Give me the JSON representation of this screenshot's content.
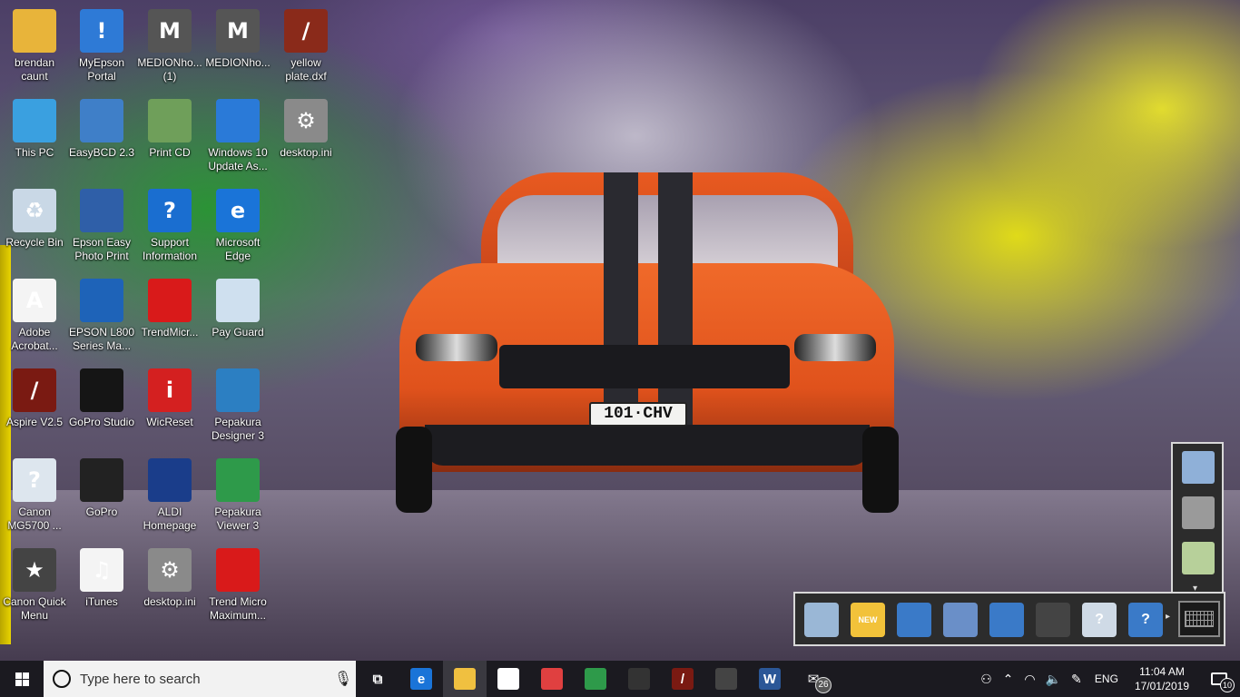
{
  "wallpaper": {
    "plate_text": "101·CHV"
  },
  "desktop_icons": [
    {
      "id": "brendan-caunt",
      "label": "brendan caunt",
      "icon": "user-folder-icon",
      "color": "#e8b43a",
      "glyph": "",
      "shortcut": false
    },
    {
      "id": "this-pc",
      "label": "This PC",
      "icon": "computer-icon",
      "color": "#3aa0e0",
      "glyph": "",
      "shortcut": false
    },
    {
      "id": "recycle-bin",
      "label": "Recycle Bin",
      "icon": "recycle-bin-icon",
      "color": "#c9d8e6",
      "glyph": "♻",
      "shortcut": false
    },
    {
      "id": "adobe-acrobat",
      "label": "Adobe Acrobat...",
      "icon": "acrobat-icon",
      "color": "#f4f4f4",
      "glyph": "A",
      "shortcut": true
    },
    {
      "id": "aspire",
      "label": "Aspire V2.5",
      "icon": "aspire-icon",
      "color": "#7a1a12",
      "glyph": "/",
      "shortcut": true
    },
    {
      "id": "canon-mg5700",
      "label": "Canon MG5700 ...",
      "icon": "canon-help-icon",
      "color": "#dde6ee",
      "glyph": "?",
      "shortcut": true
    },
    {
      "id": "canon-quick-menu",
      "label": "Canon Quick Menu",
      "icon": "canon-quick-menu-icon",
      "color": "#444",
      "glyph": "★",
      "shortcut": true
    },
    {
      "id": "myepson-portal",
      "label": "MyEpson Portal",
      "icon": "info-icon",
      "color": "#2e7ad6",
      "glyph": "!",
      "shortcut": true
    },
    {
      "id": "easybcd",
      "label": "EasyBCD 2.3",
      "icon": "easybcd-icon",
      "color": "#3f7fc8",
      "glyph": "",
      "shortcut": true
    },
    {
      "id": "epson-easy-photo-print",
      "label": "Epson Easy Photo Print",
      "icon": "photo-print-icon",
      "color": "#2f5fa8",
      "glyph": "",
      "shortcut": true
    },
    {
      "id": "epson-l800",
      "label": "EPSON L800 Series Ma...",
      "icon": "epson-manual-icon",
      "color": "#1e63b8",
      "glyph": "",
      "shortcut": true
    },
    {
      "id": "gopro-studio",
      "label": "GoPro Studio",
      "icon": "gopro-studio-icon",
      "color": "#151515",
      "glyph": "",
      "shortcut": true
    },
    {
      "id": "gopro",
      "label": "GoPro",
      "icon": "gopro-icon",
      "color": "#222",
      "glyph": "",
      "shortcut": true
    },
    {
      "id": "itunes",
      "label": "iTunes",
      "icon": "itunes-icon",
      "color": "#f4f4f4",
      "glyph": "♫",
      "shortcut": true
    },
    {
      "id": "medion-home-1",
      "label": "MEDIONho... (1)",
      "icon": "medion-icon",
      "color": "#555",
      "glyph": "M",
      "shortcut": true
    },
    {
      "id": "print-cd",
      "label": "Print CD",
      "icon": "print-cd-icon",
      "color": "#6f9f5a",
      "glyph": "",
      "shortcut": true
    },
    {
      "id": "support-information",
      "label": "Support Information",
      "icon": "help-icon",
      "color": "#1a6ed0",
      "glyph": "?",
      "shortcut": true
    },
    {
      "id": "trendmicro-1",
      "label": "TrendMicr...",
      "icon": "trendmicro-icon",
      "color": "#d91a1a",
      "glyph": "",
      "shortcut": false
    },
    {
      "id": "wicreset",
      "label": "WicReset",
      "icon": "wicreset-icon",
      "color": "#d42020",
      "glyph": "i",
      "shortcut": true
    },
    {
      "id": "aldi-homepage",
      "label": "ALDI Homepage",
      "icon": "aldi-icon",
      "color": "#1a3d8a",
      "glyph": "",
      "shortcut": false
    },
    {
      "id": "desktop-ini-1",
      "label": "desktop.ini",
      "icon": "ini-file-icon",
      "color": "#8a8a8a",
      "glyph": "⚙",
      "shortcut": false
    },
    {
      "id": "medion-home-2",
      "label": "MEDIONho...",
      "icon": "medion-icon",
      "color": "#555",
      "glyph": "M",
      "shortcut": true
    },
    {
      "id": "windows-10-update",
      "label": "Windows 10 Update As...",
      "icon": "windows-update-icon",
      "color": "#2a7ad8",
      "glyph": "",
      "shortcut": true
    },
    {
      "id": "microsoft-edge",
      "label": "Microsoft Edge",
      "icon": "edge-icon",
      "color": "#1a74d8",
      "glyph": "e",
      "shortcut": true
    },
    {
      "id": "pay-guard",
      "label": "Pay Guard",
      "icon": "pay-guard-icon",
      "color": "#cfe0ef",
      "glyph": "",
      "shortcut": true
    },
    {
      "id": "pepakura-designer",
      "label": "Pepakura Designer 3",
      "icon": "pepakura-designer-icon",
      "color": "#2c7fc2",
      "glyph": "",
      "shortcut": true
    },
    {
      "id": "pepakura-viewer",
      "label": "Pepakura Viewer 3",
      "icon": "pepakura-viewer-icon",
      "color": "#2e9a4a",
      "glyph": "",
      "shortcut": true
    },
    {
      "id": "trend-micro-maximum",
      "label": "Trend Micro Maximum...",
      "icon": "trendmicro-icon",
      "color": "#d91a1a",
      "glyph": "",
      "shortcut": true
    },
    {
      "id": "yellow-plate",
      "label": "yellow plate.dxf",
      "icon": "dxf-icon",
      "color": "#8a2a1a",
      "glyph": "/",
      "shortcut": true
    },
    {
      "id": "desktop-ini-2",
      "label": "desktop.ini",
      "icon": "ini-file-icon",
      "color": "#8a8a8a",
      "glyph": "⚙",
      "shortcut": false
    }
  ],
  "floating_toolbar": {
    "vertical_icons": [
      "photo-album-icon",
      "printer-icon",
      "photo-collage-icon"
    ],
    "horizontal_icons": [
      {
        "name": "photo-print-icon",
        "glyph": ""
      },
      {
        "name": "new-smiley-icon",
        "glyph": "NEW"
      },
      {
        "name": "globe-info-icon",
        "glyph": ""
      },
      {
        "name": "photo-shop-icon",
        "glyph": ""
      },
      {
        "name": "globe-cart-icon",
        "glyph": ""
      },
      {
        "name": "printer-user-icon",
        "glyph": ""
      },
      {
        "name": "document-help-icon",
        "glyph": "?"
      },
      {
        "name": "globe-help-icon",
        "glyph": "?"
      }
    ]
  },
  "taskbar": {
    "search_placeholder": "Type here to search",
    "apps": [
      {
        "name": "task-view-icon",
        "glyph": "⧉",
        "color": "transparent",
        "active": false
      },
      {
        "name": "edge-icon",
        "glyph": "e",
        "color": "#1a74d8",
        "active": false
      },
      {
        "name": "file-explorer-icon",
        "glyph": "",
        "color": "#f0c040",
        "active": true
      },
      {
        "name": "store-icon",
        "glyph": "",
        "color": "#fff",
        "active": false
      },
      {
        "name": "photos-mosaic-icon",
        "glyph": "",
        "color": "#e04040",
        "active": false
      },
      {
        "name": "pepakura-icon",
        "glyph": "",
        "color": "#2e9a4a",
        "active": false
      },
      {
        "name": "photos-icon",
        "glyph": "",
        "color": "#333",
        "active": false
      },
      {
        "name": "aspire-icon",
        "glyph": "/",
        "color": "#7a1a12",
        "active": false
      },
      {
        "name": "webcam-icon",
        "glyph": "",
        "color": "#444",
        "active": false
      },
      {
        "name": "word-icon",
        "glyph": "W",
        "color": "#2b5797",
        "active": false
      },
      {
        "name": "mail-icon",
        "glyph": "✉",
        "color": "transparent",
        "active": false,
        "badge": "26"
      }
    ],
    "tray": {
      "language": "ENG",
      "time": "11:04 AM",
      "date": "17/01/2019",
      "notification_count": "10"
    }
  }
}
